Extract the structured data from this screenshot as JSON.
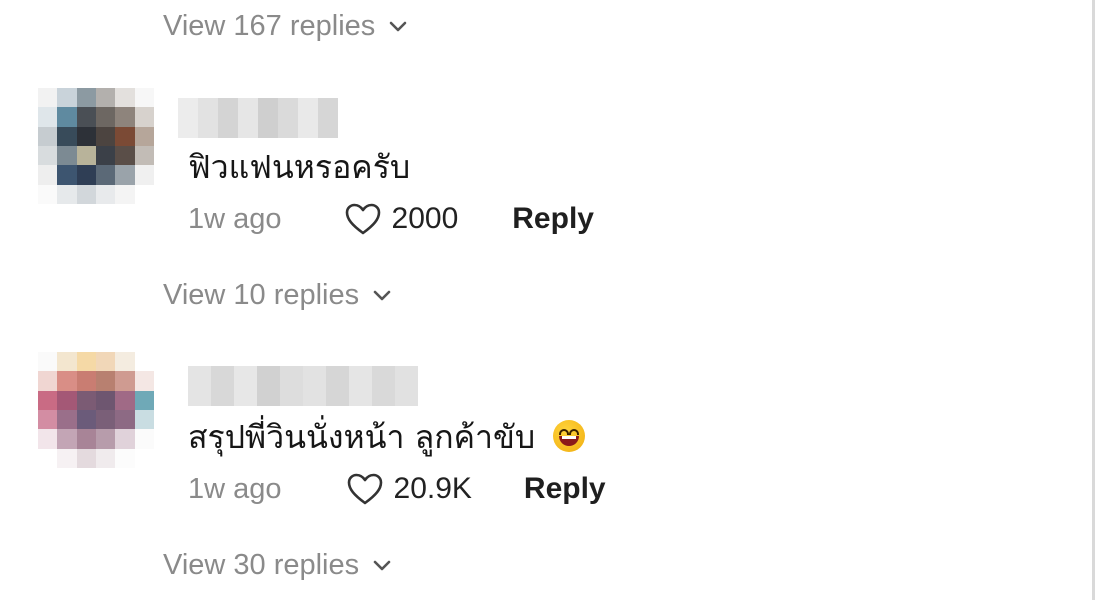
{
  "thread": {
    "top_view_replies": "View 167 replies",
    "comments": [
      {
        "text": "ฟิวแฟนหรอครับ",
        "time": "1w ago",
        "likes": "2000",
        "reply_label": "Reply",
        "view_replies": "View 10 replies"
      },
      {
        "text": "สรุปพี่วินนั่งหน้า ลูกค้าขับ",
        "emoji": "grinning-squinting-face",
        "time": "1w ago",
        "likes": "20.9K",
        "reply_label": "Reply",
        "view_replies": "View 30 replies"
      }
    ]
  },
  "colors": {
    "secondary_text": "#8a8a8a",
    "primary_text": "#161616",
    "background": "#ffffff"
  }
}
